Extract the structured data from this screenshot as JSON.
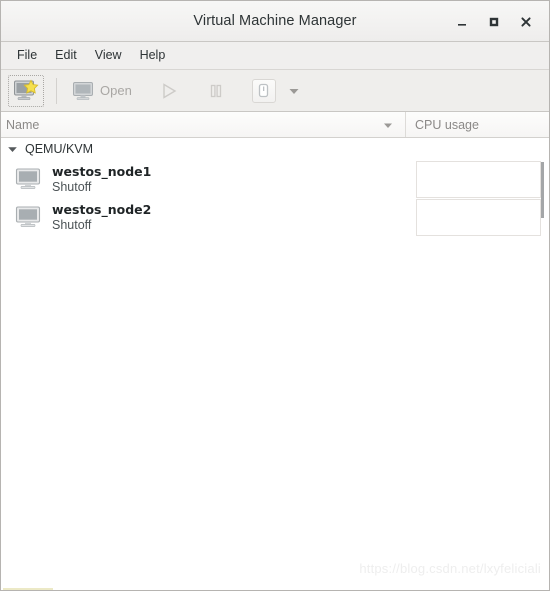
{
  "window": {
    "title": "Virtual Machine Manager",
    "controls": [
      {
        "name": "minimize-button",
        "glyph": "minimize"
      },
      {
        "name": "maximize-button",
        "glyph": "maximize"
      },
      {
        "name": "close-button",
        "glyph": "close"
      }
    ]
  },
  "menubar": {
    "items": [
      {
        "label": "File"
      },
      {
        "label": "Edit"
      },
      {
        "label": "View"
      },
      {
        "label": "Help"
      }
    ]
  },
  "toolbar": {
    "new_vm": {
      "icon": "new-vm-monitor-star-icon",
      "label": ""
    },
    "open": {
      "icon": "monitor-icon",
      "label": "Open",
      "enabled": false
    },
    "run": {
      "icon": "play-icon",
      "enabled": false
    },
    "pause": {
      "icon": "pause-icon",
      "enabled": false
    },
    "shutdown": {
      "icon": "shutdown-icon",
      "enabled": false
    },
    "shutdown_menu": {
      "icon": "chevron-down-icon"
    }
  },
  "columns": [
    {
      "key": "name",
      "label": "Name",
      "sort_icon": "sort-descending-caret-icon"
    },
    {
      "key": "cpu",
      "label": "CPU usage"
    }
  ],
  "connection_group": {
    "label": "QEMU/KVM",
    "expander_icon": "triangle-down-icon",
    "expanded": true
  },
  "vms": [
    {
      "name": "westos_node1",
      "state": "Shutoff",
      "icon": "monitor-icon",
      "cpu_graph": "empty"
    },
    {
      "name": "westos_node2",
      "state": "Shutoff",
      "icon": "monitor-icon",
      "cpu_graph": "empty"
    }
  ],
  "watermark": "https://blog.csdn.net/lxyfeliciali",
  "colors": {
    "window_bg": "#ffffff",
    "chrome_bg": "#efeeec",
    "titlebar_bg": "#f2f1f0",
    "border": "#c9c7c4",
    "text": "#2e3436",
    "muted_text": "#8b8987",
    "disabled_text": "#a9a7a4",
    "graph_border": "#e4e1de",
    "star_accent": "#f5e050"
  }
}
